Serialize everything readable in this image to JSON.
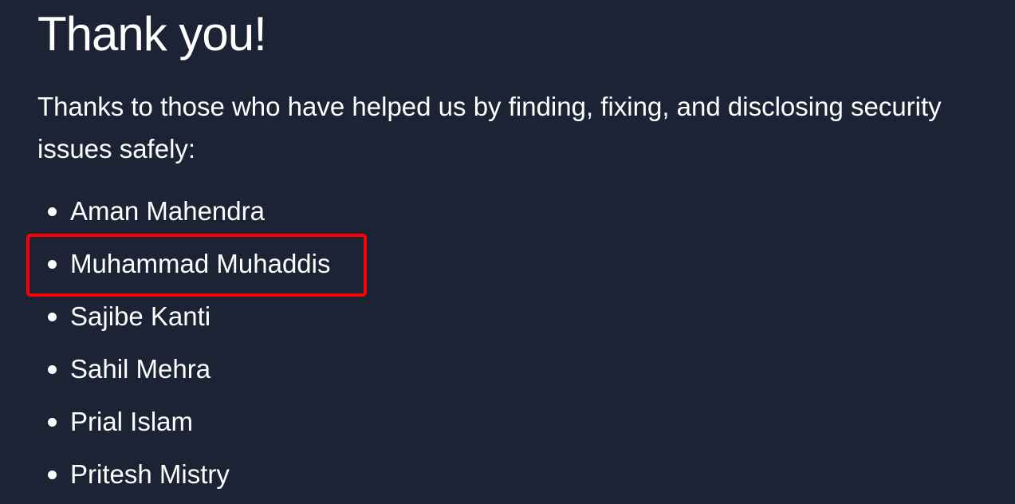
{
  "page": {
    "title": "Thank you!",
    "intro": "Thanks to those who have helped us by finding, fixing, and disclosing security issues safely:"
  },
  "credits": {
    "names": [
      "Aman Mahendra",
      "Muhammad Muhaddis",
      "Sajibe Kanti",
      "Sahil Mehra",
      "Prial Islam",
      "Pritesh Mistry"
    ],
    "highlighted_name": "Muhammad Muhaddis"
  },
  "colors": {
    "background": "#1b2334",
    "text": "#ffffff",
    "highlight_border": "#ff0000"
  }
}
